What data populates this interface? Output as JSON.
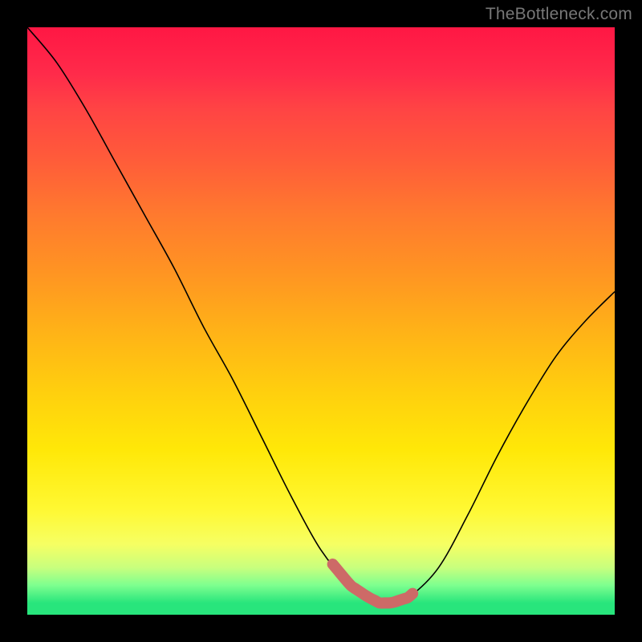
{
  "watermark": "TheBottleneck.com",
  "colors": {
    "frame": "#000000",
    "curve": "#000000",
    "highlight": "#cd6a67",
    "gradient_stops": [
      "#ff1744",
      "#ff4444",
      "#ff7a2e",
      "#ffb317",
      "#ffe808",
      "#f6ff63",
      "#7dff8f",
      "#28e57c"
    ]
  },
  "chart_data": {
    "type": "line",
    "title": "",
    "xlabel": "",
    "ylabel": "",
    "xlim": [
      0,
      100
    ],
    "ylim": [
      0,
      100
    ],
    "grid": false,
    "legend": false,
    "x": [
      0,
      5,
      10,
      15,
      20,
      25,
      30,
      35,
      40,
      45,
      50,
      55,
      58,
      60,
      62,
      65,
      70,
      75,
      80,
      85,
      90,
      95,
      100
    ],
    "values": [
      100,
      94,
      86,
      77,
      68,
      59,
      49,
      40,
      30,
      20,
      11,
      5,
      3,
      2,
      2,
      3,
      8,
      17,
      27,
      36,
      44,
      50,
      55
    ],
    "highlight_segment": {
      "x_start": 52,
      "x_end": 66,
      "note": "thick pink band along curve near minimum"
    },
    "annotations": []
  }
}
